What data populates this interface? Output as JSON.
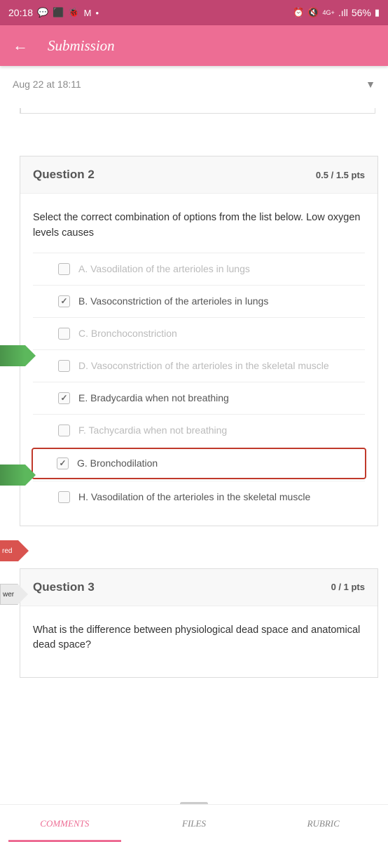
{
  "status": {
    "time": "20:18",
    "network": "4G+",
    "signal": ".ıll",
    "battery": "56%"
  },
  "app": {
    "title": "Submission"
  },
  "date": "Aug 22 at 18:11",
  "q2": {
    "title": "Question 2",
    "pts": "0.5 / 1.5 pts",
    "prompt": "Select the correct combination of options from the list below. Low oxygen levels causes",
    "options": [
      {
        "label": "A. Vasodilation of the arterioles in lungs",
        "checked": false,
        "faded": true
      },
      {
        "label": "B. Vasoconstriction of the arterioles in lungs",
        "checked": true,
        "faded": false
      },
      {
        "label": "C. Bronchoconstriction",
        "checked": false,
        "faded": true
      },
      {
        "label": "D. Vasoconstriction of the arterioles in the skeletal muscle",
        "checked": false,
        "faded": true
      },
      {
        "label": "E. Bradycardia when not breathing",
        "checked": true,
        "faded": false
      },
      {
        "label": "F. Tachycardia when not breathing",
        "checked": false,
        "faded": true
      },
      {
        "label": "G. Bronchodilation",
        "checked": true,
        "faded": false
      },
      {
        "label": "H. Vasodilation of the arterioles in the skeletal muscle",
        "checked": false,
        "faded": false
      }
    ]
  },
  "q3": {
    "title": "Question 3",
    "pts": "0 / 1 pts",
    "prompt": "What is the difference between physiological dead space and anatomical dead space?"
  },
  "markers": {
    "red": "red",
    "wer": "wer"
  },
  "tabs": {
    "comments": "COMMENTS",
    "files": "FILES",
    "rubric": "RUBRIC"
  }
}
